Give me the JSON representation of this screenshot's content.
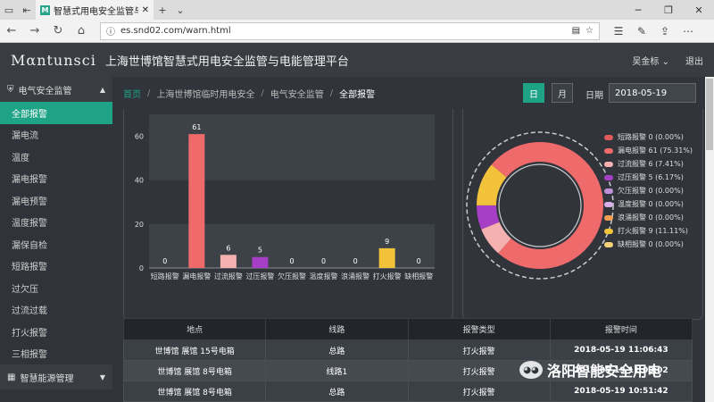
{
  "browser": {
    "tab_title": "智慧式用电安全监管与电",
    "url": "es.snd02.com/warn.html",
    "new_tab": "+"
  },
  "app": {
    "logo": "Mαntunsci",
    "title": "上海世博馆智慧式用电安全监管与电能管理平台",
    "user": "吴金标",
    "logout": "退出"
  },
  "sidebar": {
    "group1": "电气安全监管",
    "items": [
      "全部报警",
      "漏电流",
      "温度",
      "漏电报警",
      "漏电预警",
      "温度报警",
      "漏保自检",
      "短路报警",
      "过欠压",
      "过流过载",
      "打火报警",
      "三相报警"
    ],
    "group2": "智慧能源管理"
  },
  "breadcrumb": {
    "home": "首页",
    "site": "上海世博馆临时用电安全",
    "section": "电气安全监管",
    "current": "全部报警"
  },
  "filter": {
    "day": "日",
    "month": "月",
    "date_label": "日期",
    "date_value": "2018-05-19"
  },
  "chart_data": [
    {
      "type": "bar",
      "categories": [
        "短路报警",
        "漏电报警",
        "过流报警",
        "过压报警",
        "欠压报警",
        "温度报警",
        "浪涌报警",
        "打火报警",
        "缺相报警"
      ],
      "values": [
        0,
        61,
        6,
        5,
        0,
        0,
        0,
        9,
        0
      ],
      "ylim": [
        0,
        70
      ],
      "yticks": [
        0,
        20,
        40,
        60
      ],
      "colors": [
        "#ef6b6b",
        "#ef6b6b",
        "#f5b0b0",
        "#a63fc5",
        "#c08fd8",
        "#d9b0e8",
        "#f0a050",
        "#f2c23b",
        "#f5d078"
      ],
      "grid": true
    },
    {
      "type": "pie",
      "donut": true,
      "legend_position": "right",
      "labels": [
        "短路报警",
        "漏电报警",
        "过流报警",
        "过压报警",
        "欠压报警",
        "温度报警",
        "浪涌报警",
        "打火报警",
        "缺相报警"
      ],
      "values": [
        0,
        61,
        6,
        5,
        0,
        0,
        0,
        9,
        0
      ],
      "legend_text": [
        "短路报警 0 (0.00%)",
        "漏电报警 61 (75.31%)",
        "过流报警 6 (7.41%)",
        "过压报警 5 (6.17%)",
        "欠压报警 0 (0.00%)",
        "温度报警 0 (0.00%)",
        "浪涌报警 0 (0.00%)",
        "打火报警 9 (11.11%)",
        "缺相报警 0 (0.00%)"
      ],
      "colors": [
        "#e05a5a",
        "#ef6b6b",
        "#f5b0b0",
        "#a63fc5",
        "#c08fd8",
        "#d9b0e8",
        "#f0a050",
        "#f2c23b",
        "#f5d078"
      ]
    }
  ],
  "table": {
    "headers": [
      "地点",
      "线路",
      "报警类型",
      "报警时间"
    ],
    "rows": [
      [
        "世博馆 展馆 15号电箱",
        "总路",
        "打火报警",
        "2018-05-19 11:06:43"
      ],
      [
        "世博馆 展馆 8号电箱",
        "线路1",
        "打火报警",
        "2018-05-19 11:00:02"
      ],
      [
        "世博馆 展馆 8号电箱",
        "总路",
        "打火报警",
        "2018-05-19 10:51:42"
      ]
    ]
  },
  "watermark": "洛阳智能安全用电"
}
